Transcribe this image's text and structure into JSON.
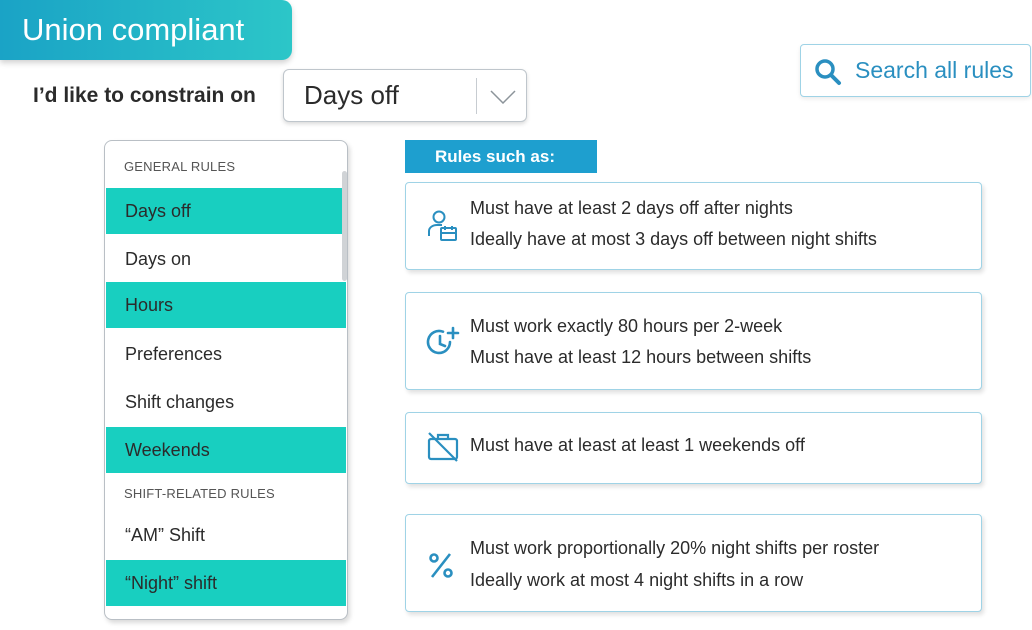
{
  "badge": {
    "label": "Union compliant"
  },
  "constrain": {
    "label": "I’d like to constrain on",
    "selected": "Days off"
  },
  "search": {
    "label": "Search all rules"
  },
  "list": {
    "general_heading": "GENERAL RULES",
    "general_items": [
      {
        "label": "Days off",
        "selected": true
      },
      {
        "label": "Days on",
        "selected": false
      },
      {
        "label": "Hours",
        "selected": true
      },
      {
        "label": "Preferences",
        "selected": false
      },
      {
        "label": "Shift changes",
        "selected": false
      },
      {
        "label": "Weekends",
        "selected": true
      }
    ],
    "shift_heading": "SHIFT-RELATED RULES",
    "shift_items": [
      {
        "label": "“AM” Shift",
        "selected": false
      },
      {
        "label": "“Night” shift",
        "selected": true
      }
    ]
  },
  "rules": {
    "heading": "Rules such as:",
    "cards": [
      {
        "icon": "person-calendar-icon",
        "lines": [
          "Must have at least 2 days off after nights",
          "Ideally have at most 3 days off between night shifts"
        ]
      },
      {
        "icon": "clock-plus-icon",
        "lines": [
          "Must work exactly 80 hours per 2-week",
          "Must have at least 12 hours between shifts"
        ]
      },
      {
        "icon": "briefcase-off-icon",
        "lines": [
          "Must have at least at least 1 weekends off"
        ]
      },
      {
        "icon": "percent-icon",
        "lines": [
          "Must work proportionally 20% night shifts per roster",
          "Ideally work at most 4 night shifts in a row"
        ]
      }
    ]
  },
  "colors": {
    "accent": "#18cfc0",
    "brand_blue": "#1e9fcf",
    "icon_blue": "#2a8fc0"
  }
}
